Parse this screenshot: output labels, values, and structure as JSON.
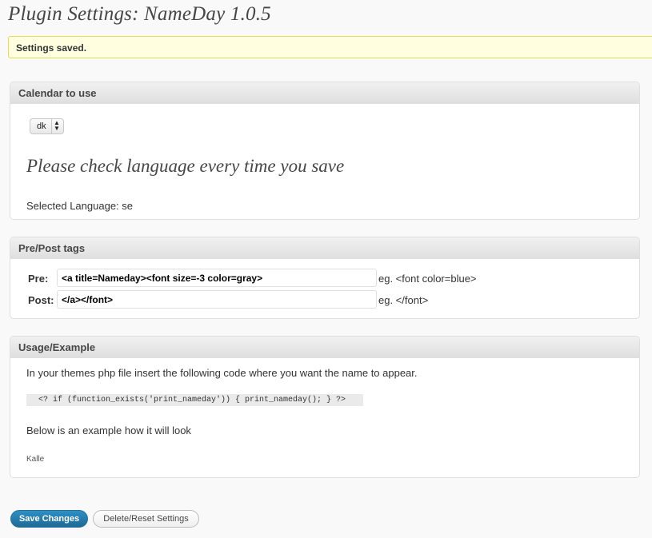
{
  "page": {
    "title": "Plugin Settings: NameDay 1.0.5"
  },
  "notice": {
    "text": "Settings saved."
  },
  "calendar": {
    "header": "Calendar to use",
    "select_value": "dk",
    "heading": "Please check language every time you save",
    "selected_language": "Selected Language: se"
  },
  "tags": {
    "header": "Pre/Post tags",
    "pre_label": "Pre:",
    "pre_value": "<a title=Nameday><font size=-3 color=gray>",
    "pre_example": "eg. <font color=blue>",
    "post_label": "Post:",
    "post_value": "</a></font>",
    "post_example": "eg. </font>"
  },
  "usage": {
    "header": "Usage/Example",
    "instructions": "In your themes php file insert the following code where you want the name to appear.",
    "code": "<? if (function_exists('print_nameday')) { print_nameday(); } ?>",
    "below": "Below is an example how it will look",
    "example_output": "Kalle"
  },
  "buttons": {
    "save": "Save Changes",
    "reset": "Delete/Reset Settings"
  },
  "colors": {
    "accent": "#21759b",
    "notice_bg": "#ffffe0",
    "notice_border": "#e6db55"
  }
}
